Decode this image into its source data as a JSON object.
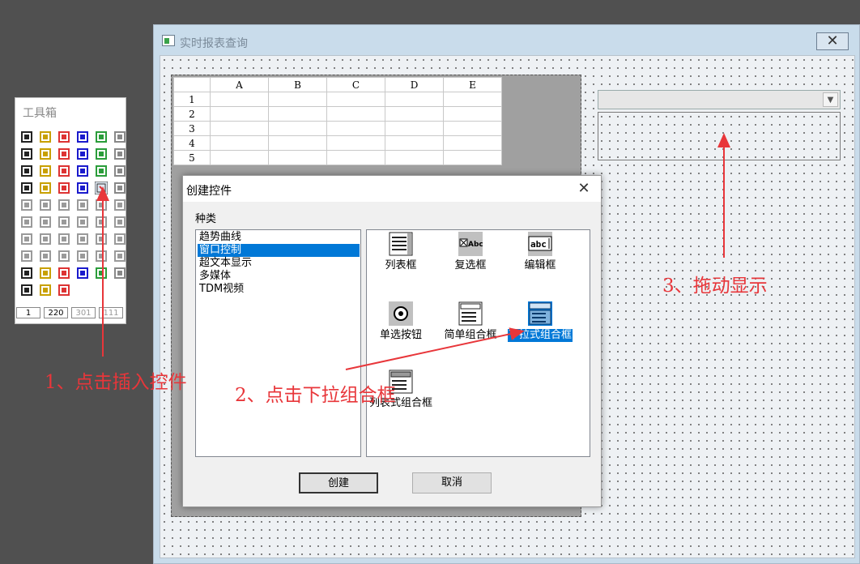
{
  "main_window": {
    "title": "实时报表查询",
    "close_glyph": "✕"
  },
  "grid": {
    "columns": [
      "A",
      "B",
      "C",
      "D",
      "E"
    ],
    "rows": [
      "1",
      "2",
      "3",
      "4",
      "5"
    ]
  },
  "toolbox": {
    "title": "工具箱",
    "status": [
      "1",
      "220",
      "301",
      "111"
    ]
  },
  "dialog": {
    "title": "创建控件",
    "close_glyph": "✕",
    "kind_label": "种类",
    "kinds": [
      {
        "label": "趋势曲线",
        "selected": false
      },
      {
        "label": "窗口控制",
        "selected": true
      },
      {
        "label": "超文本显示",
        "selected": false
      },
      {
        "label": "多媒体",
        "selected": false
      },
      {
        "label": "TDM视频",
        "selected": false
      }
    ],
    "controls": [
      {
        "label": "列表框",
        "icon": "listbox-icon"
      },
      {
        "label": "复选框",
        "icon": "checkbox-icon"
      },
      {
        "label": "编辑框",
        "icon": "editbox-icon"
      },
      {
        "label": "单选按钮",
        "icon": "radio-button-icon"
      },
      {
        "label": "简单组合框",
        "icon": "simple-combo-icon"
      },
      {
        "label": "下拉式组合框",
        "icon": "dropdown-combo-icon",
        "selected": true
      },
      {
        "label": "列表式组合框",
        "icon": "list-combo-icon"
      }
    ],
    "create_label": "创建",
    "cancel_label": "取消"
  },
  "annotations": {
    "step1": "1、点击插入控件",
    "step2": "2、点击下拉组合框",
    "step3": "3、拖动显示",
    "color": "#e8363a"
  },
  "colors": {
    "selection": "#0078d7",
    "window_bg": "#c9dceb",
    "desktop_bg": "#505050"
  }
}
